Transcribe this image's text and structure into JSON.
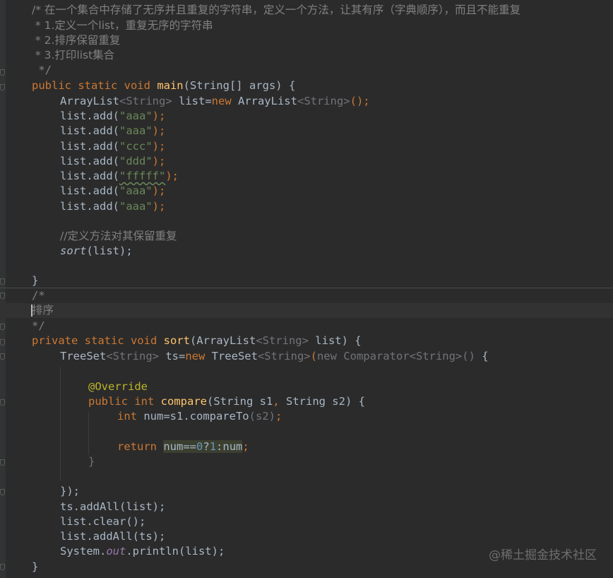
{
  "editor": {
    "lines": {
      "c1": "/* 在一个集合中存储了无序并且重复的字符串，定义一个方法，让其有序（字典顺序），而且不能重复",
      "c2": " * 1.定义一个list，重复无序的字符串",
      "c3": " * 2.排序保留重复",
      "c4": " * 3.打印list集合",
      "c5": " */",
      "main_kw": "public static void ",
      "main_name": "main",
      "main_rest": "(String[] args) {",
      "al_type": "ArrayList",
      "al_gen": "<String>",
      "al_mid": " list=",
      "al_new": "new ",
      "al_ctor": "ArrayList",
      "al_gen2": "<String>",
      "al_end": "();",
      "add_pre": "list.add(",
      "add_post": ");",
      "add_vals": [
        "\"aaa\"",
        "\"aaa\"",
        "\"ccc\"",
        "\"ddd\"",
        "\"fffff\"",
        "\"aaa\"",
        "\"aaa\""
      ],
      "comment_sort": "//定义方法对其保留重复",
      "sort_call_name": "sort",
      "sort_call_rest": "(list);",
      "close_main": "}",
      "cm_open": "/*",
      "cm_body": "排序",
      "cm_close": "*/",
      "sort_kw": "private static void ",
      "sort_name": "sort",
      "sort_rest": "(ArrayList",
      "sort_gen": "<String>",
      "sort_end": " list) {",
      "ts_type": "TreeSet",
      "ts_gen": "<String>",
      "ts_mid": " ts=",
      "ts_new": "new ",
      "ts_ctor": "TreeSet",
      "ts_gen2": "<String>",
      "ts_paren": "(",
      "ts_anon": "new Comparator<String>()",
      "ts_brace": " {",
      "override": "@Override",
      "cmp_kw": "public int ",
      "cmp_name": "compare",
      "cmp_rest": "(String s1",
      "cmp_comma": ",",
      "cmp_rest2": " String s2",
      "cmp_end": ") {",
      "int_kw": "int ",
      "int_rest": "num=s1.compareTo",
      "int_arg": "(s2)",
      "int_end": ";",
      "ret_kw": "return ",
      "ret_a": "num==",
      "ret_zero": "0",
      "ret_b": "?",
      "ret_one": "1",
      "ret_c": ":num",
      "ret_end": ";",
      "inner_close": "}",
      "anon_close": "});",
      "addall1": "ts.addAll(list);",
      "clear": "list.clear();",
      "addall2": "list.addAll(ts);",
      "println_a": "System.",
      "println_out": "out",
      "println_b": ".println(list);",
      "close_sort": "}"
    }
  },
  "watermark": "@稀土掘金技术社区"
}
